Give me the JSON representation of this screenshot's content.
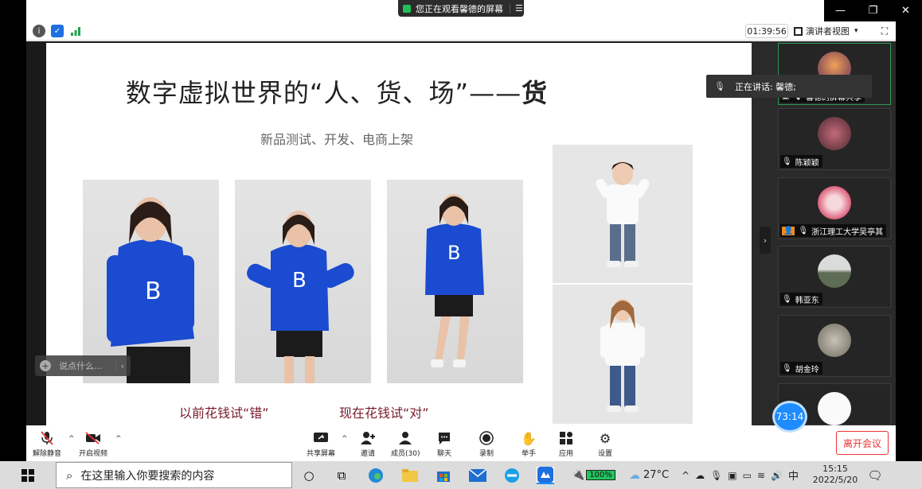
{
  "titlebar": {
    "share_banner": "您正在观看馨德的屏幕",
    "banner_menu": "☰",
    "minimize": "—",
    "restore": "❐",
    "close": "✕"
  },
  "meetbar": {
    "timer": "01:39:56",
    "view_label": "演讲者视图",
    "view_caret": "▾",
    "fullscreen": "⛶"
  },
  "slide": {
    "title_main": "数字虚拟世界的“人、货、场”——",
    "title_bold": "货",
    "subtitle": "新品测试、开发、电商上架",
    "caption_left": "以前花钱试“错”",
    "caption_right": "现在花钱试“对”"
  },
  "speaking": {
    "text": "正在讲话: 馨德;"
  },
  "chat": {
    "placeholder": "说点什么...",
    "plus": "+",
    "arrow": "‹"
  },
  "participants": [
    {
      "name": "馨德的屏幕共享",
      "avatar_color": "#c86c4a"
    },
    {
      "name": "陈颖颖",
      "avatar_color": "#8a4a52"
    },
    {
      "name": "浙江理工大学吴亭其",
      "avatar_color": "#e0708a"
    },
    {
      "name": "韩亚东",
      "avatar_color": "#7f8a86"
    },
    {
      "name": "胡金玲",
      "avatar_color": "#9a9a90"
    }
  ],
  "badge": "73:14",
  "controls": {
    "mute": "解除静音",
    "video": "开启视频",
    "share": "共享屏幕",
    "invite": "邀请",
    "members": "成员(30)",
    "chat": "聊天",
    "record": "录制",
    "raise_hand": "举手",
    "apps": "应用",
    "settings": "设置",
    "leave": "离开会议"
  },
  "taskbar": {
    "search_placeholder": "在这里输入你要搜索的内容",
    "battery": "100%",
    "temperature": "27°C",
    "ime": "中",
    "time": "15:15",
    "date": "2022/5/20"
  },
  "colors": {
    "accent_blue": "#1e8cff",
    "leave_red": "#e33333",
    "caption": "#7a1a28"
  }
}
